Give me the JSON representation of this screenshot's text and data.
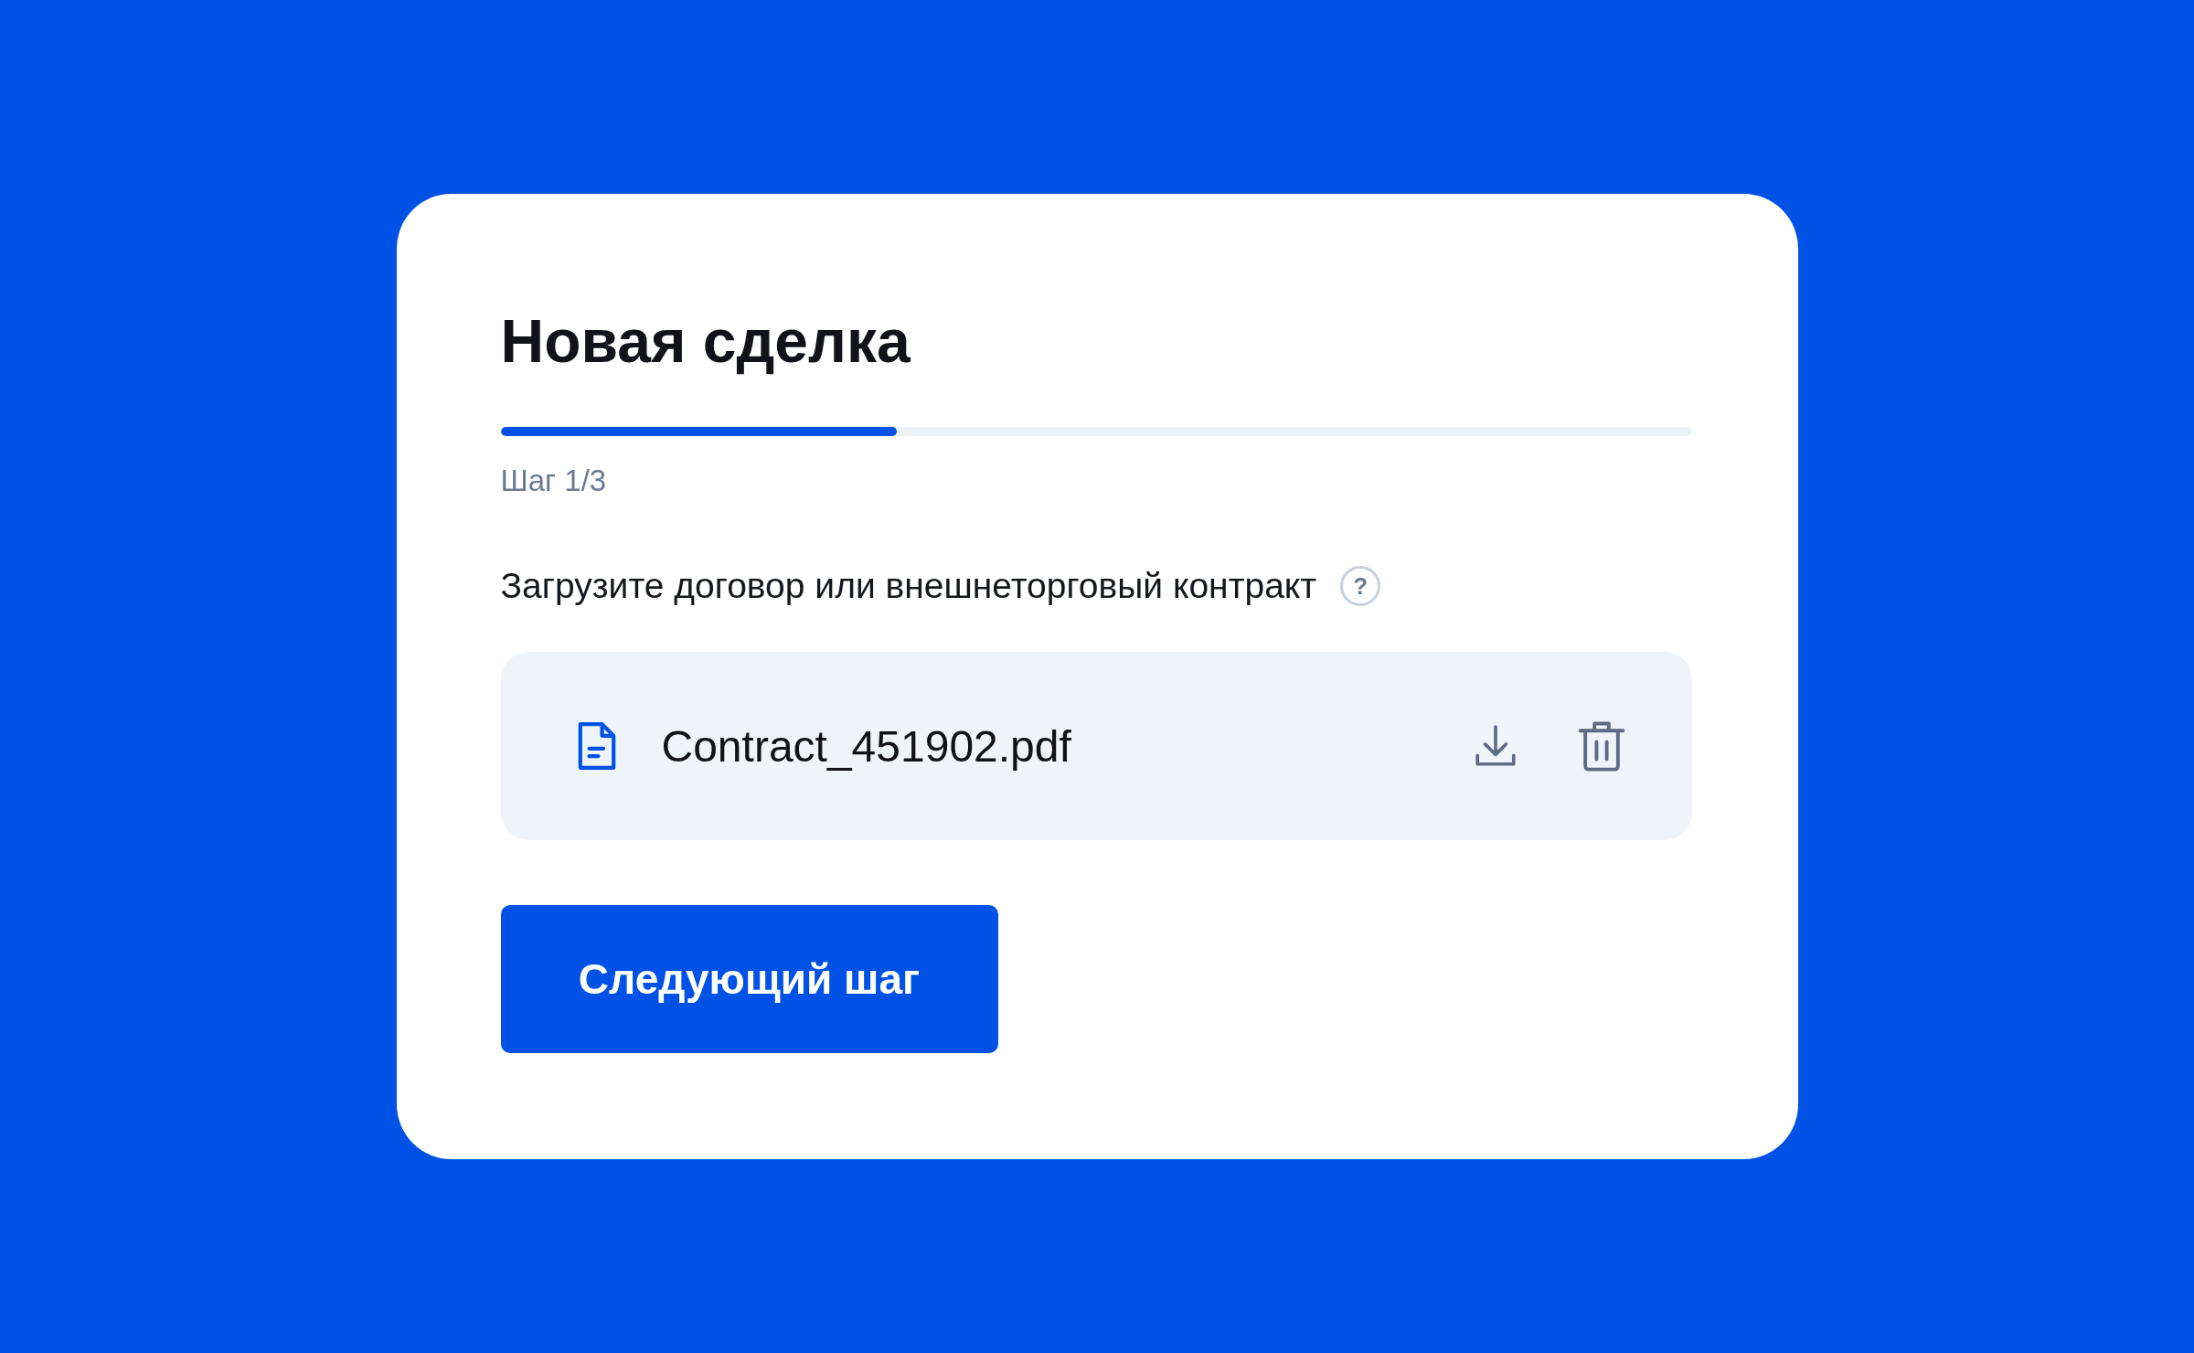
{
  "title": "Новая сделка",
  "progress": {
    "level": 0.333,
    "label": "Шаг 1/3"
  },
  "upload": {
    "label": "Загрузите договор или внешнеторговый контракт",
    "help": "?"
  },
  "file": {
    "name": "Contract_451902.pdf"
  },
  "next_button": "Следующий шаг"
}
